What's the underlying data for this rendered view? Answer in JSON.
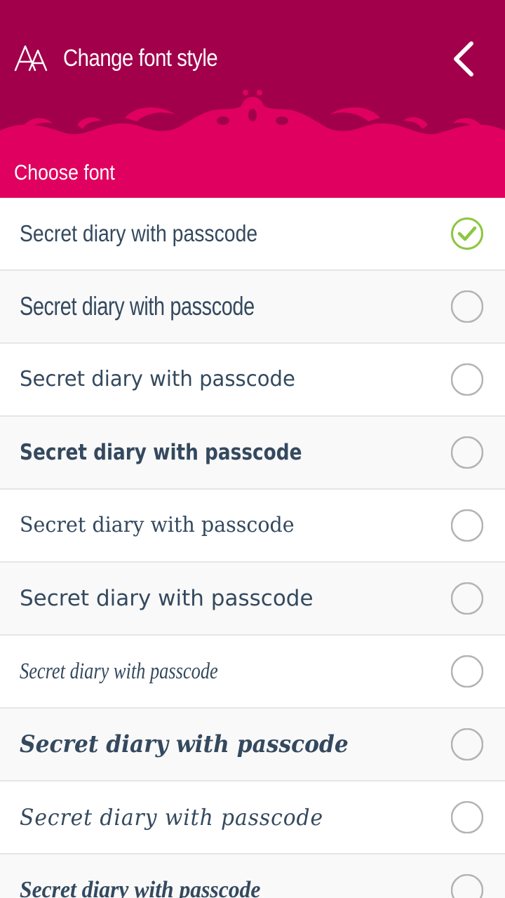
{
  "header": {
    "title": "Change font style",
    "app_icon": "font-style-icon",
    "back_icon": "chevron-left-icon",
    "background_color": "#a2004b",
    "ornament_color": "#e0005f"
  },
  "section": {
    "label": "Choose font",
    "background_color": "#e0005f"
  },
  "fonts": {
    "selected_index": 0,
    "check_color": "#8cc63f",
    "items": [
      {
        "label": "Secret diary with passcode",
        "selected": true
      },
      {
        "label": "Secret diary with passcode",
        "selected": false
      },
      {
        "label": "Secret diary with passcode",
        "selected": false
      },
      {
        "label": "Secret diary with passcode",
        "selected": false
      },
      {
        "label": "Secret diary with passcode",
        "selected": false
      },
      {
        "label": "Secret diary with passcode",
        "selected": false
      },
      {
        "label": "Secret diary with passcode",
        "selected": false
      },
      {
        "label": "Secret diary with passcode",
        "selected": false
      },
      {
        "label": "Secret diary with passcode",
        "selected": false
      },
      {
        "label": "Secret diary with passcode",
        "selected": false
      }
    ]
  }
}
